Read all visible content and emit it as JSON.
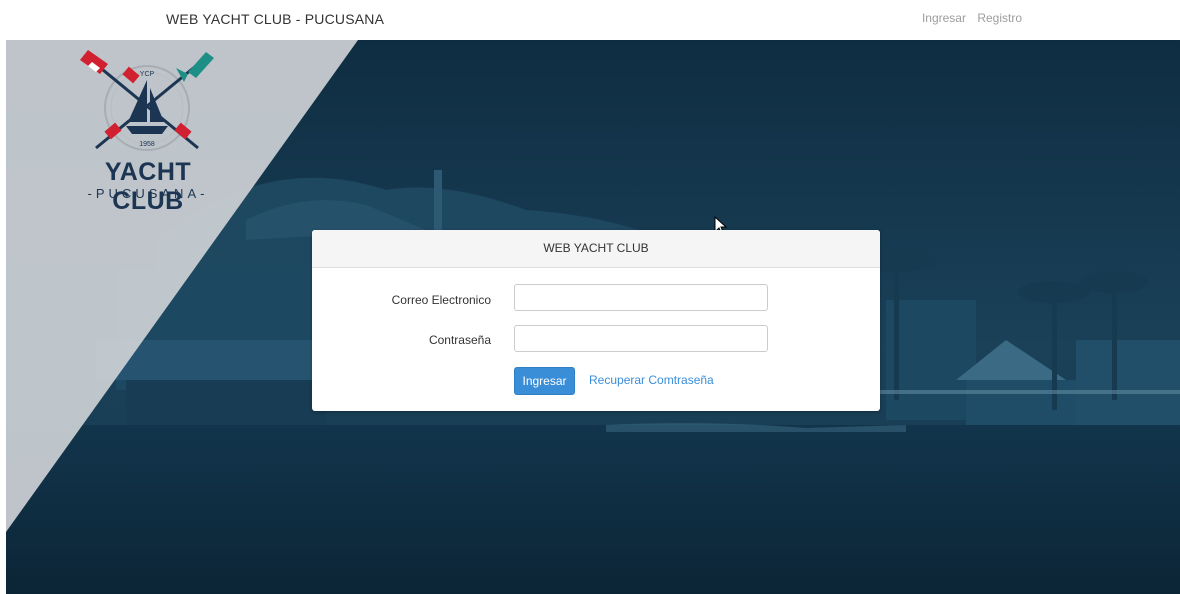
{
  "navbar": {
    "brand": "WEB YACHT CLUB - PUCUSANA",
    "links": [
      "Ingresar",
      "Registro"
    ]
  },
  "logo": {
    "badge_top": "YCP",
    "badge_year": "1958",
    "title": "YACHT CLUB",
    "subtitle": "-PUCUSANA-"
  },
  "login": {
    "heading": "WEB YACHT CLUB",
    "email_label": "Correo Electronico",
    "email_value": "",
    "password_label": "Contraseña",
    "password_value": "",
    "submit_label": "Ingresar",
    "recover_label": "Recuperar Comtraseña"
  },
  "colors": {
    "primary": "#3a8ed8",
    "hero_overlay": "#123246",
    "logo_navy": "#1c3552",
    "flag_red": "#d1202f",
    "flag_teal": "#1e8f85"
  },
  "icons": [
    "sailboat-icon",
    "crossed-oars-icon",
    "mouse-cursor-icon"
  ]
}
